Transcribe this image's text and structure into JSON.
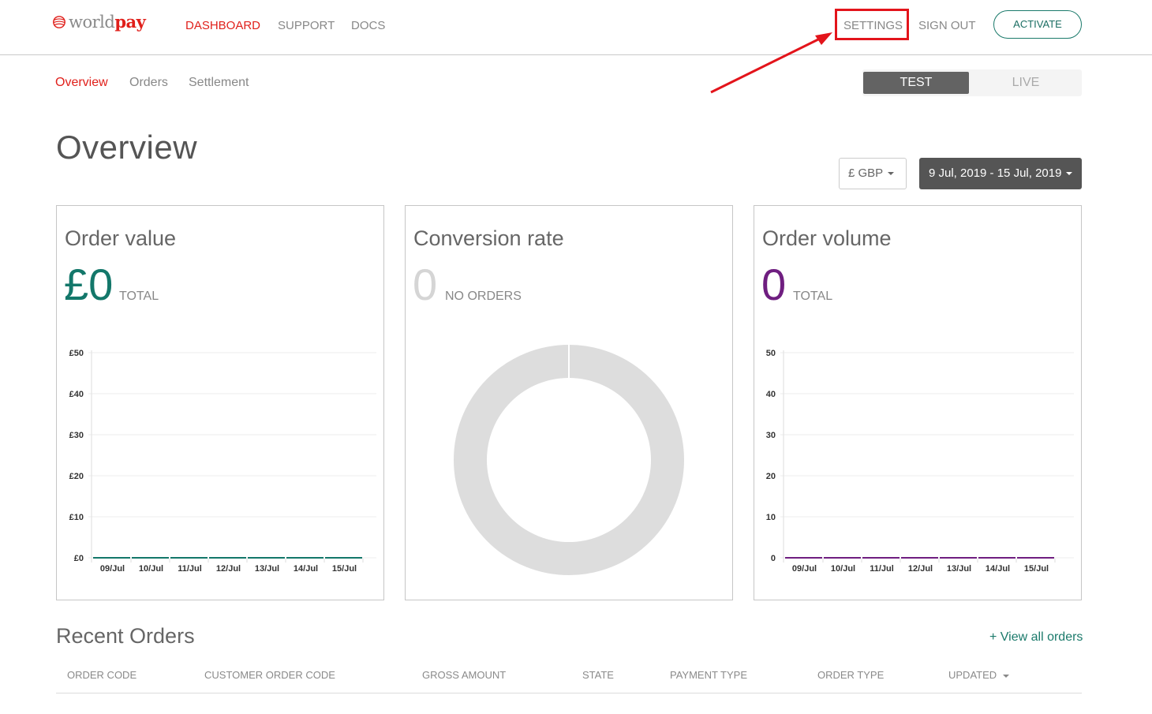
{
  "header": {
    "logo": {
      "part1": "world",
      "part2": "pay"
    },
    "nav": [
      {
        "label": "DASHBOARD",
        "active": true
      },
      {
        "label": "SUPPORT",
        "active": false
      },
      {
        "label": "DOCS",
        "active": false
      }
    ],
    "settings_label": "SETTINGS",
    "signout_label": "SIGN OUT",
    "activate_label": "ACTIVATE"
  },
  "subnav": [
    {
      "label": "Overview",
      "active": true
    },
    {
      "label": "Orders",
      "active": false
    },
    {
      "label": "Settlement",
      "active": false
    }
  ],
  "env_toggle": {
    "test": "TEST",
    "live": "LIVE",
    "selected": "TEST"
  },
  "page_title": "Overview",
  "filters": {
    "currency": "£ GBP",
    "date_range": "9 Jul, 2019 - 15 Jul, 2019"
  },
  "cards": {
    "order_value": {
      "title": "Order value",
      "value": "£0",
      "unit": "TOTAL",
      "color": "#13776a"
    },
    "conversion_rate": {
      "title": "Conversion rate",
      "value": "0",
      "unit": "NO ORDERS",
      "color": "#d5d5d5"
    },
    "order_volume": {
      "title": "Order volume",
      "value": "0",
      "unit": "TOTAL",
      "color": "#6f1e80"
    }
  },
  "chart_data": [
    {
      "type": "bar",
      "title": "Order value",
      "categories": [
        "09/Jul",
        "10/Jul",
        "11/Jul",
        "12/Jul",
        "13/Jul",
        "14/Jul",
        "15/Jul"
      ],
      "values": [
        0,
        0,
        0,
        0,
        0,
        0,
        0
      ],
      "yticks": [
        "£0",
        "£10",
        "£20",
        "£30",
        "£40",
        "£50"
      ],
      "ylim": [
        0,
        50
      ],
      "grid": true,
      "color": "#13776a"
    },
    {
      "type": "pie",
      "title": "Conversion rate",
      "labels": [
        "No orders"
      ],
      "values": [
        1
      ],
      "donut": true,
      "color": "#dddddd"
    },
    {
      "type": "bar",
      "title": "Order volume",
      "categories": [
        "09/Jul",
        "10/Jul",
        "11/Jul",
        "12/Jul",
        "13/Jul",
        "14/Jul",
        "15/Jul"
      ],
      "values": [
        0,
        0,
        0,
        0,
        0,
        0,
        0
      ],
      "yticks": [
        "0",
        "10",
        "20",
        "30",
        "40",
        "50"
      ],
      "ylim": [
        0,
        50
      ],
      "grid": true,
      "color": "#6f1e80"
    }
  ],
  "recent_orders": {
    "title": "Recent Orders",
    "view_all": "+ View all orders",
    "columns": [
      "ORDER CODE",
      "CUSTOMER ORDER CODE",
      "GROSS AMOUNT",
      "STATE",
      "PAYMENT TYPE",
      "ORDER TYPE",
      "UPDATED"
    ],
    "rows": []
  },
  "annotation": {
    "highlight": "SETTINGS",
    "color": "#e3141b"
  }
}
